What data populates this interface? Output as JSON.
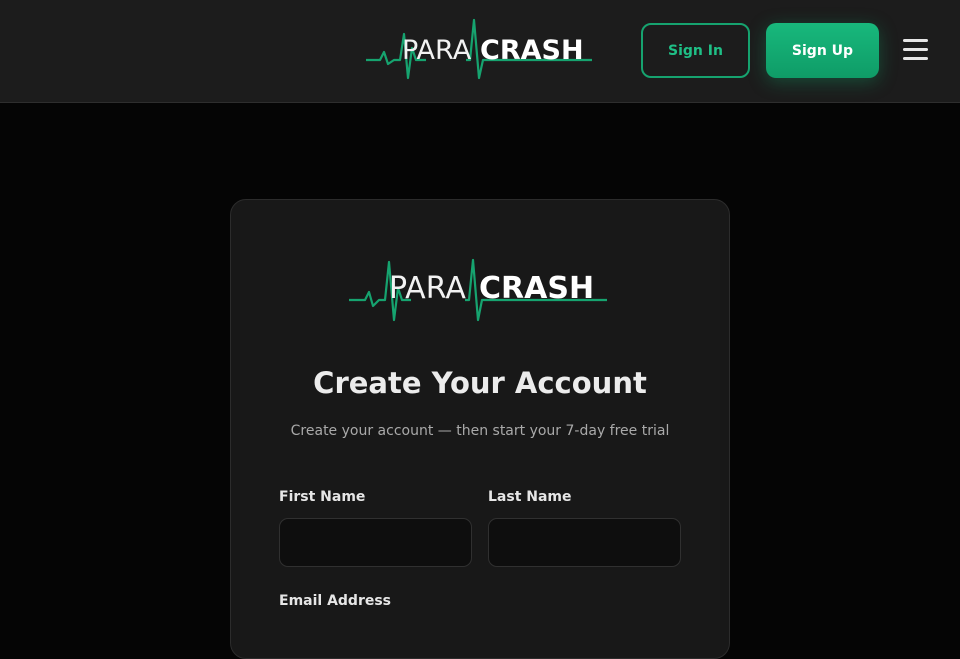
{
  "header": {
    "logo": {
      "left_text": "PARA",
      "right_text": "CRASH"
    },
    "signin_label": "Sign In",
    "signup_label": "Sign Up",
    "menu_icon": "hamburger-menu-icon"
  },
  "card": {
    "logo": {
      "left_text": "PARA",
      "right_text": "CRASH"
    },
    "title": "Create Your Account",
    "subtitle": "Create your account — then start your 7-day free trial",
    "fields": {
      "first_name": {
        "label": "First Name",
        "value": ""
      },
      "last_name": {
        "label": "Last Name",
        "value": ""
      },
      "email": {
        "label": "Email Address"
      }
    }
  },
  "colors": {
    "accent": "#16a36f",
    "accent_bright": "#1fbf86",
    "header_bg": "#1c1c1c",
    "page_bg": "#050505",
    "card_bg": "#181818"
  }
}
